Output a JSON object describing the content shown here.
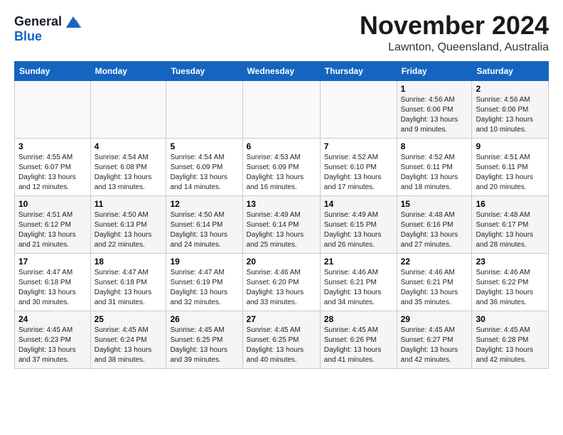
{
  "logo": {
    "general": "General",
    "blue": "Blue"
  },
  "title": "November 2024",
  "location": "Lawnton, Queensland, Australia",
  "days_of_week": [
    "Sunday",
    "Monday",
    "Tuesday",
    "Wednesday",
    "Thursday",
    "Friday",
    "Saturday"
  ],
  "weeks": [
    [
      {
        "day": "",
        "info": ""
      },
      {
        "day": "",
        "info": ""
      },
      {
        "day": "",
        "info": ""
      },
      {
        "day": "",
        "info": ""
      },
      {
        "day": "",
        "info": ""
      },
      {
        "day": "1",
        "info": "Sunrise: 4:56 AM\nSunset: 6:06 PM\nDaylight: 13 hours\nand 9 minutes."
      },
      {
        "day": "2",
        "info": "Sunrise: 4:56 AM\nSunset: 6:06 PM\nDaylight: 13 hours\nand 10 minutes."
      }
    ],
    [
      {
        "day": "3",
        "info": "Sunrise: 4:55 AM\nSunset: 6:07 PM\nDaylight: 13 hours\nand 12 minutes."
      },
      {
        "day": "4",
        "info": "Sunrise: 4:54 AM\nSunset: 6:08 PM\nDaylight: 13 hours\nand 13 minutes."
      },
      {
        "day": "5",
        "info": "Sunrise: 4:54 AM\nSunset: 6:09 PM\nDaylight: 13 hours\nand 14 minutes."
      },
      {
        "day": "6",
        "info": "Sunrise: 4:53 AM\nSunset: 6:09 PM\nDaylight: 13 hours\nand 16 minutes."
      },
      {
        "day": "7",
        "info": "Sunrise: 4:52 AM\nSunset: 6:10 PM\nDaylight: 13 hours\nand 17 minutes."
      },
      {
        "day": "8",
        "info": "Sunrise: 4:52 AM\nSunset: 6:11 PM\nDaylight: 13 hours\nand 18 minutes."
      },
      {
        "day": "9",
        "info": "Sunrise: 4:51 AM\nSunset: 6:11 PM\nDaylight: 13 hours\nand 20 minutes."
      }
    ],
    [
      {
        "day": "10",
        "info": "Sunrise: 4:51 AM\nSunset: 6:12 PM\nDaylight: 13 hours\nand 21 minutes."
      },
      {
        "day": "11",
        "info": "Sunrise: 4:50 AM\nSunset: 6:13 PM\nDaylight: 13 hours\nand 22 minutes."
      },
      {
        "day": "12",
        "info": "Sunrise: 4:50 AM\nSunset: 6:14 PM\nDaylight: 13 hours\nand 24 minutes."
      },
      {
        "day": "13",
        "info": "Sunrise: 4:49 AM\nSunset: 6:14 PM\nDaylight: 13 hours\nand 25 minutes."
      },
      {
        "day": "14",
        "info": "Sunrise: 4:49 AM\nSunset: 6:15 PM\nDaylight: 13 hours\nand 26 minutes."
      },
      {
        "day": "15",
        "info": "Sunrise: 4:48 AM\nSunset: 6:16 PM\nDaylight: 13 hours\nand 27 minutes."
      },
      {
        "day": "16",
        "info": "Sunrise: 4:48 AM\nSunset: 6:17 PM\nDaylight: 13 hours\nand 28 minutes."
      }
    ],
    [
      {
        "day": "17",
        "info": "Sunrise: 4:47 AM\nSunset: 6:18 PM\nDaylight: 13 hours\nand 30 minutes."
      },
      {
        "day": "18",
        "info": "Sunrise: 4:47 AM\nSunset: 6:18 PM\nDaylight: 13 hours\nand 31 minutes."
      },
      {
        "day": "19",
        "info": "Sunrise: 4:47 AM\nSunset: 6:19 PM\nDaylight: 13 hours\nand 32 minutes."
      },
      {
        "day": "20",
        "info": "Sunrise: 4:46 AM\nSunset: 6:20 PM\nDaylight: 13 hours\nand 33 minutes."
      },
      {
        "day": "21",
        "info": "Sunrise: 4:46 AM\nSunset: 6:21 PM\nDaylight: 13 hours\nand 34 minutes."
      },
      {
        "day": "22",
        "info": "Sunrise: 4:46 AM\nSunset: 6:21 PM\nDaylight: 13 hours\nand 35 minutes."
      },
      {
        "day": "23",
        "info": "Sunrise: 4:46 AM\nSunset: 6:22 PM\nDaylight: 13 hours\nand 36 minutes."
      }
    ],
    [
      {
        "day": "24",
        "info": "Sunrise: 4:45 AM\nSunset: 6:23 PM\nDaylight: 13 hours\nand 37 minutes."
      },
      {
        "day": "25",
        "info": "Sunrise: 4:45 AM\nSunset: 6:24 PM\nDaylight: 13 hours\nand 38 minutes."
      },
      {
        "day": "26",
        "info": "Sunrise: 4:45 AM\nSunset: 6:25 PM\nDaylight: 13 hours\nand 39 minutes."
      },
      {
        "day": "27",
        "info": "Sunrise: 4:45 AM\nSunset: 6:25 PM\nDaylight: 13 hours\nand 40 minutes."
      },
      {
        "day": "28",
        "info": "Sunrise: 4:45 AM\nSunset: 6:26 PM\nDaylight: 13 hours\nand 41 minutes."
      },
      {
        "day": "29",
        "info": "Sunrise: 4:45 AM\nSunset: 6:27 PM\nDaylight: 13 hours\nand 42 minutes."
      },
      {
        "day": "30",
        "info": "Sunrise: 4:45 AM\nSunset: 6:28 PM\nDaylight: 13 hours\nand 42 minutes."
      }
    ]
  ]
}
